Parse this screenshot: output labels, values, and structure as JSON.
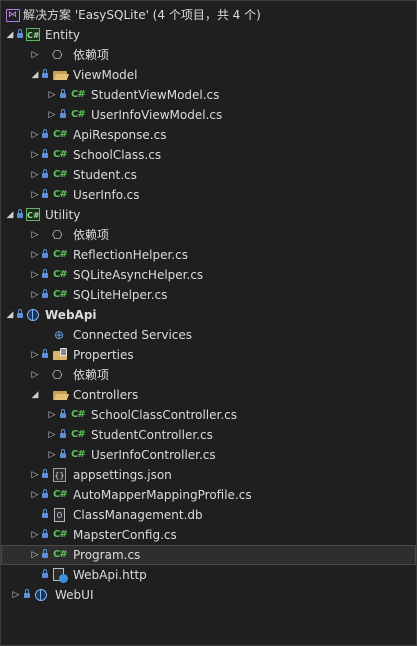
{
  "solution": {
    "label": "解决方案 'EasySQLite' (4 个项目，共 4 个)",
    "icon": "solution-icon"
  },
  "tree": {
    "entity": {
      "label": "Entity",
      "icon": "csharp-project-icon",
      "dependencies": "依赖项",
      "viewmodel_folder": "ViewModel",
      "viewmodel_files": [
        "StudentViewModel.cs",
        "UserInfoViewModel.cs"
      ],
      "files": [
        "ApiResponse.cs",
        "SchoolClass.cs",
        "Student.cs",
        "UserInfo.cs"
      ]
    },
    "utility": {
      "label": "Utility",
      "icon": "csharp-project-icon",
      "dependencies": "依赖项",
      "files": [
        "ReflectionHelper.cs",
        "SQLiteAsyncHelper.cs",
        "SQLiteHelper.cs"
      ]
    },
    "webapi": {
      "label": "WebApi",
      "icon": "web-project-icon",
      "connected_services": "Connected Services",
      "properties": "Properties",
      "dependencies": "依赖项",
      "controllers_folder": "Controllers",
      "controller_files": [
        "SchoolClassController.cs",
        "StudentController.cs",
        "UserInfoController.cs"
      ],
      "appsettings": "appsettings.json",
      "automapper": "AutoMapperMappingProfile.cs",
      "db": "ClassManagement.db",
      "mapster": "MapsterConfig.cs",
      "program": "Program.cs",
      "http": "WebApi.http"
    },
    "webui": {
      "label": "WebUI",
      "icon": "web-project-icon"
    }
  },
  "selected_item": "Program.cs",
  "colors": {
    "background": "#1f1f1f",
    "text": "#dcdcdc",
    "csharp_file": "#59c259",
    "lock": "#5b8fd6",
    "folder": "#d9b46a",
    "selected_row": "#2e2e2e"
  }
}
